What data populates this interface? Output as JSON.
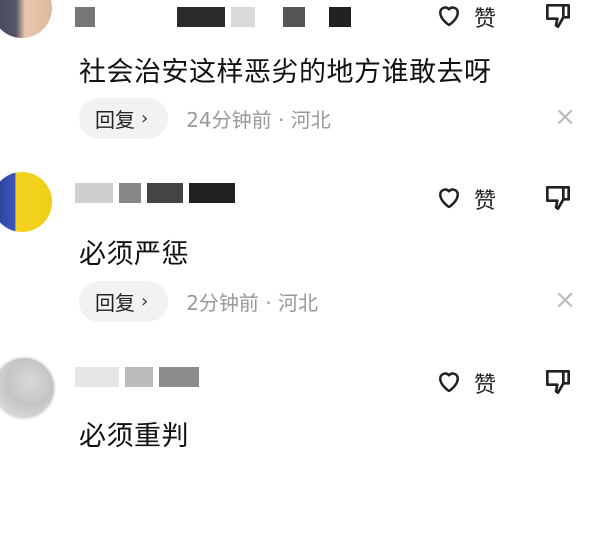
{
  "comments": [
    {
      "text": "社会治安这样恶劣的地方谁敢去呀",
      "like_label": "赞",
      "reply_label": "回复",
      "reply_chevron": "›",
      "meta": "24分钟前 · 河北",
      "dismiss": "×"
    },
    {
      "text": "必须严惩",
      "like_label": "赞",
      "reply_label": "回复",
      "reply_chevron": "›",
      "meta": "2分钟前 · 河北",
      "dismiss": "×"
    },
    {
      "text": "必须重判",
      "like_label": "赞"
    }
  ],
  "icons": {
    "like": "heart-outline-icon",
    "dislike": "thumbs-down-icon",
    "dismiss": "close-icon"
  }
}
